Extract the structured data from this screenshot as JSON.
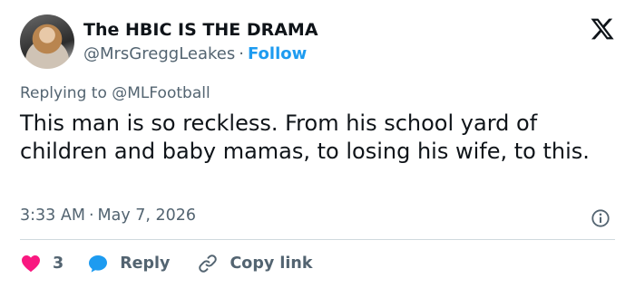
{
  "author": {
    "display_name": "The HBIC IS THE DRAMA",
    "handle": "@MrsGreggLeakes",
    "separator": "·",
    "follow_label": "Follow"
  },
  "reply_context": {
    "prefix": "Replying to ",
    "mention": "@MLFootball"
  },
  "tweet": {
    "text": "This man is so reckless. From his school yard of children and baby mamas, to losing his wife, to this.",
    "time": "3:33 AM",
    "separator": "·",
    "date": "May 7, 2026"
  },
  "actions": {
    "like_count": "3",
    "reply_label": "Reply",
    "copy_link_label": "Copy link"
  },
  "icons": {
    "logo": "x-logo-icon",
    "like": "heart-icon",
    "reply": "speech-bubble-icon",
    "copy": "link-icon",
    "info": "info-icon"
  },
  "colors": {
    "like": "#f91880",
    "reply": "#1d9bf0",
    "follow": "#1d9bf0",
    "secondary_text": "#536471",
    "primary_text": "#0f1419"
  }
}
